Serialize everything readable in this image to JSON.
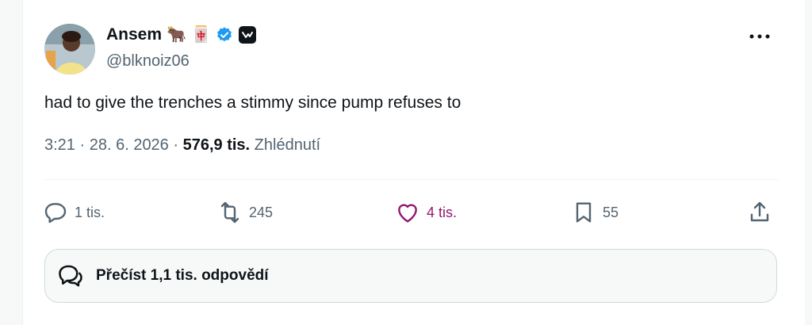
{
  "author": {
    "display_name": "Ansem",
    "emojis": [
      "🐂",
      "🀄"
    ],
    "handle": "@blknoiz06",
    "verified": true
  },
  "tweet": {
    "text": "had to give the trenches a stimmy since pump refuses to",
    "time": "3:21",
    "date": "28. 6. 2026",
    "views_count": "576,9 tis.",
    "views_label": "Zhlédnutí"
  },
  "actions": {
    "replies": "1 tis.",
    "retweets": "245",
    "likes": "4 tis.",
    "bookmarks": "55"
  },
  "read_replies": {
    "label": "Přečíst 1,1 tis. odpovědí"
  },
  "colors": {
    "accent": "#1d9bf0",
    "like": "#91176c",
    "text_secondary": "#536471"
  }
}
